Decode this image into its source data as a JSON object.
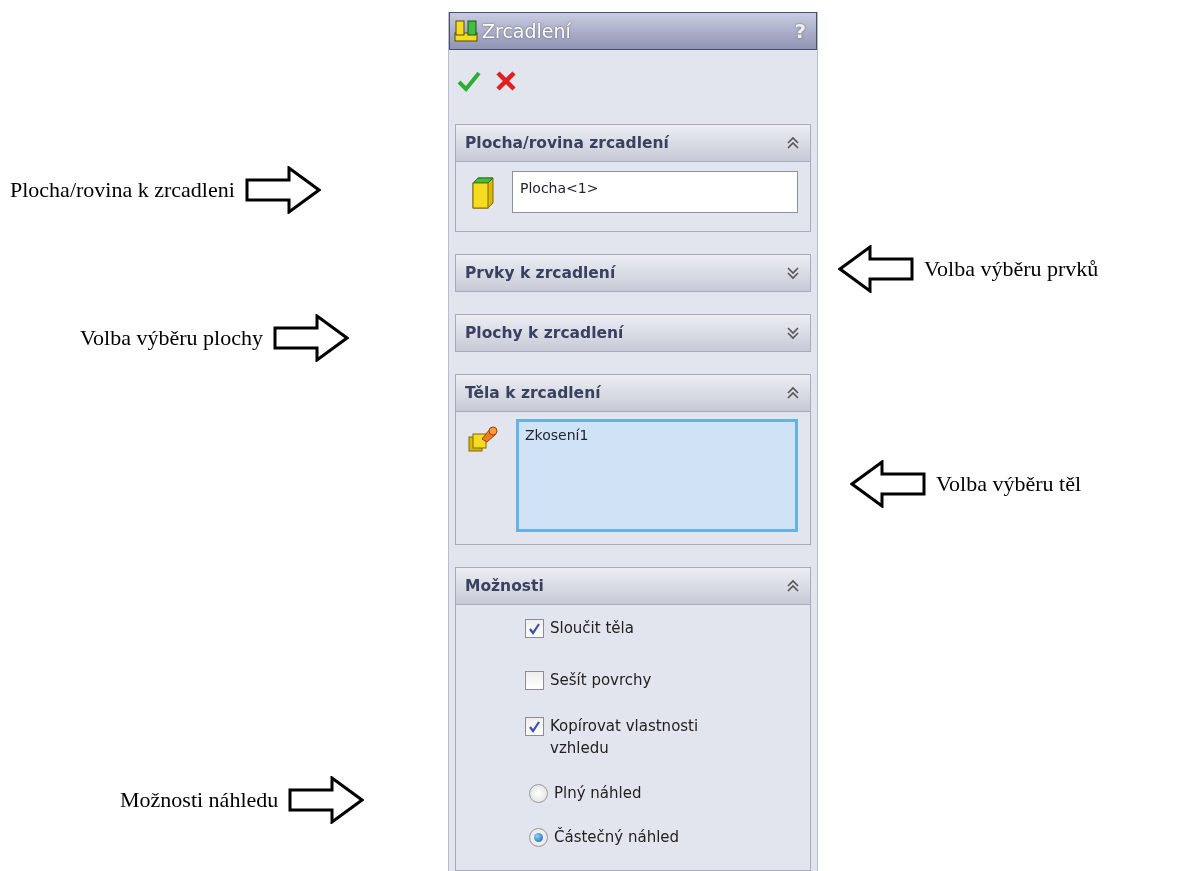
{
  "panel": {
    "title": "Zrcadlení",
    "help": "?",
    "sections": [
      {
        "kind": "field",
        "title": "Plocha/rovina zrcadlení",
        "expanded": true,
        "value": "Plocha<1>"
      },
      {
        "title": "Prvky k zrcadlení",
        "expanded": false
      },
      {
        "title": "Plochy k zrcadlení",
        "expanded": false
      },
      {
        "kind": "list",
        "title": "Těla k zrcadlení",
        "expanded": true,
        "value": "Zkosení1"
      },
      {
        "kind": "options",
        "title": "Možnosti",
        "expanded": true,
        "options": [
          {
            "kind": "checkbox",
            "label": "Sloučit těla",
            "checked": true
          },
          {
            "kind": "checkbox",
            "label": "Sešít povrchy",
            "checked": false
          },
          {
            "kind": "checkbox",
            "label": "Kopírovat vlastnosti vzhledu",
            "checked": true
          },
          {
            "kind": "radio",
            "label": "Plný náhled",
            "selected": false
          },
          {
            "kind": "radio",
            "label": "Částečný náhled",
            "selected": true
          }
        ]
      }
    ]
  },
  "callouts": [
    {
      "kind": "left",
      "text": "Plocha/rovina k zrcadleni"
    },
    {
      "kind": "right",
      "text": "Volba výběru prvků"
    },
    {
      "kind": "left",
      "text": "Volba výběru plochy"
    },
    {
      "kind": "right",
      "text": "Volba výběru těl"
    },
    {
      "kind": "left",
      "text": "Možnosti náhledu"
    }
  ]
}
